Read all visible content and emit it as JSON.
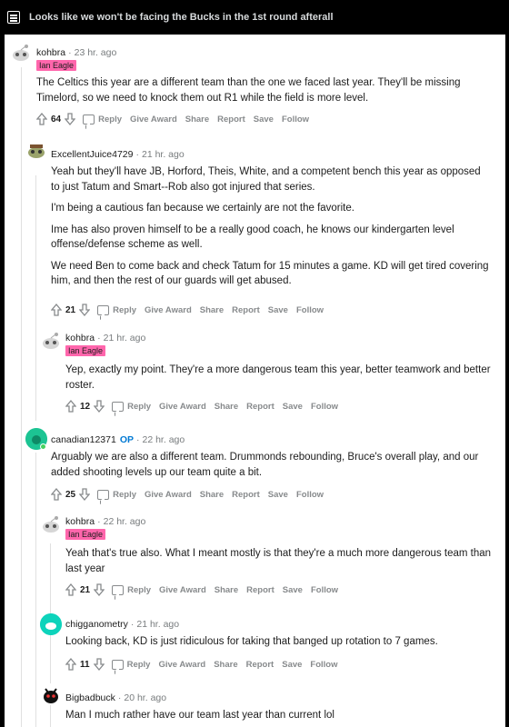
{
  "post": {
    "title": "Looks like we won't be facing the Bucks in the 1st round afterall"
  },
  "action_labels": {
    "reply": "Reply",
    "give_award": "Give Award",
    "share": "Share",
    "report": "Report",
    "save": "Save",
    "follow": "Follow"
  },
  "comments": [
    {
      "author": "kohbra",
      "time": "23 hr. ago",
      "flair": "Ian Eagle",
      "score": "64",
      "body": [
        "The Celtics this year are a different team than the one we faced last year. They'll be missing Timelord, so we need to knock them out R1 while the field is more level."
      ]
    },
    {
      "author": "ExcellentJuice4729",
      "time": "21 hr. ago",
      "score": "21",
      "body": [
        "Yeah but they'll have JB, Horford, Theis, White, and a competent bench this year as opposed to just Tatum and Smart--Rob also got injured that series.",
        "I'm being a cautious fan because we certainly are not the favorite.",
        "Ime has also proven himself to be a really good coach, he knows our kindergarten level offense/defense scheme as well.",
        "We need Ben to come back and check Tatum for 15 minutes a game. KD will get tired covering him, and then the rest of our guards will get abused."
      ]
    },
    {
      "author": "kohbra",
      "time": "21 hr. ago",
      "flair": "Ian Eagle",
      "score": "12",
      "body": [
        "Yep, exactly my point. They're a more dangerous team this year, better teamwork and better roster."
      ]
    },
    {
      "author": "canadian12371",
      "op": "OP",
      "time": "22 hr. ago",
      "score": "25",
      "body": [
        "Arguably we are also a different team. Drummonds rebounding, Bruce's overall play, and our added shooting levels up our team quite a bit."
      ]
    },
    {
      "author": "kohbra",
      "time": "22 hr. ago",
      "flair": "Ian Eagle",
      "score": "21",
      "body": [
        "Yeah that's true also. What I meant mostly is that they're a much more dangerous team than last year"
      ]
    },
    {
      "author": "chigganometry",
      "time": "21 hr. ago",
      "score": "11",
      "body": [
        "Looking back, KD is just ridiculous for taking that banged up rotation to 7 games."
      ]
    },
    {
      "author": "Bigbadbuck",
      "time": "20 hr. ago",
      "body": [
        "Man I much rather have our team last year than current lol"
      ]
    }
  ]
}
